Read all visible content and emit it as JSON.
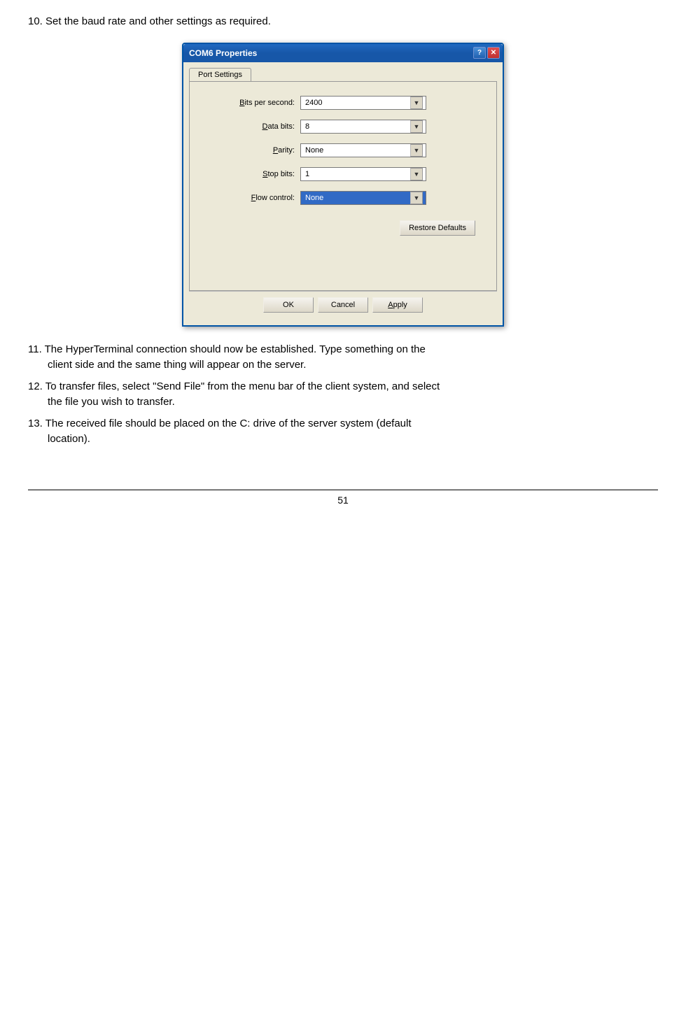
{
  "page": {
    "step10_label": "10.",
    "step10_text": "Set the baud rate and other settings as required.",
    "dialog": {
      "title": "COM6 Properties",
      "tab_active": "Port Settings",
      "fields": [
        {
          "label": "Bits per second:",
          "label_underline": "B",
          "value": "2400",
          "highlighted": false
        },
        {
          "label": "Data bits:",
          "label_underline": "D",
          "value": "8",
          "highlighted": false
        },
        {
          "label": "Parity:",
          "label_underline": "P",
          "value": "None",
          "highlighted": false
        },
        {
          "label": "Stop bits:",
          "label_underline": "S",
          "value": "1",
          "highlighted": false
        },
        {
          "label": "Flow control:",
          "label_underline": "F",
          "value": "None",
          "highlighted": true
        }
      ],
      "restore_defaults_label": "Restore Defaults",
      "buttons": [
        "OK",
        "Cancel",
        "Apply"
      ]
    },
    "steps": [
      {
        "number": "11.",
        "text": "The HyperTerminal connection should now be established. Type something on the",
        "continuation": "client side and the same thing will appear on the server."
      },
      {
        "number": "12.",
        "text": "To transfer files, select \"Send File\" from the menu bar of the client system, and select",
        "continuation": "the file you wish to transfer."
      },
      {
        "number": "13.",
        "text": "The received file should be placed on the C: drive of the server system (default",
        "continuation": "location)."
      }
    ],
    "page_number": "51"
  }
}
